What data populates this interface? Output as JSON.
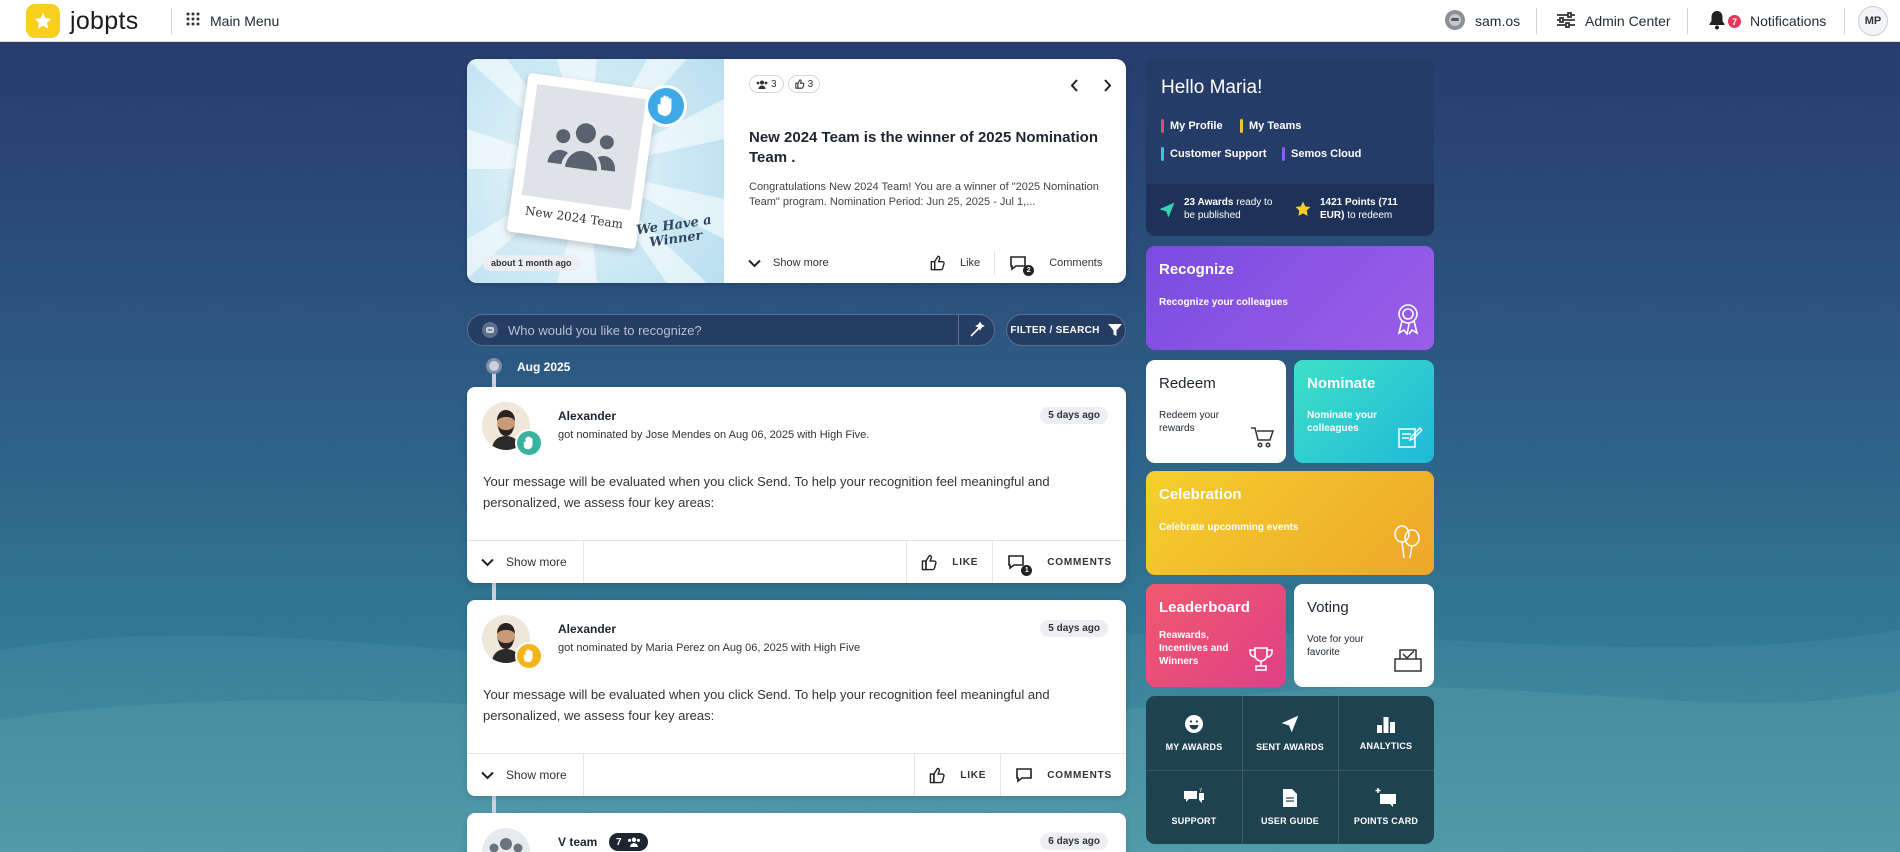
{
  "app": {
    "logo_text": "jobpts"
  },
  "topbar": {
    "main_menu": "Main Menu",
    "user": "sam.os",
    "admin": "Admin Center",
    "notifications": "Notifications",
    "notif_count": "7",
    "avatar_initials": "MP"
  },
  "feature": {
    "members_count": "3",
    "likes_count": "3",
    "img_caption": "New 2024 Team",
    "winner_text": "We Have a Winner",
    "time": "about 1 month ago",
    "title": "New 2024 Team is the winner of 2025 Nomination Team .",
    "body": "Congratulations New 2024 Team! You are a winner of \"2025 Nomination Team\" program. Nomination Period: Jun 25, 2025 - Jul 1,...",
    "show_more": "Show more",
    "like": "Like",
    "comments": "Comments",
    "comments_count": "2"
  },
  "search": {
    "placeholder": "Who would you like to recognize?",
    "filter_label": "FILTER / SEARCH"
  },
  "timeline": {
    "date": "Aug 2025"
  },
  "posts": [
    {
      "name": "Alexander",
      "subtitle": "got nominated by Jose Mendes on Aug 06, 2025 with High Five.",
      "ago": "5 days ago",
      "message": "Your message will be evaluated when you click Send. To help your recognition feel meaningful and personalized, we assess four key areas:",
      "show_more": "Show more",
      "like": "LIKE",
      "comments": "COMMENTS",
      "comments_count": "1"
    },
    {
      "name": "Alexander",
      "subtitle": "got nominated by Maria Perez on Aug 06, 2025 with High Five",
      "ago": "5 days ago",
      "message": "Your message will be evaluated when you click Send. To help your recognition feel meaningful and personalized, we assess four key areas:",
      "show_more": "Show more",
      "like": "LIKE",
      "comments": "COMMENTS"
    },
    {
      "name": "V team",
      "members": "7",
      "ago": "6 days ago"
    }
  ],
  "hello": {
    "greeting": "Hello Maria!",
    "links": [
      "My Profile",
      "My Teams",
      "Customer Support",
      "Semos Cloud"
    ],
    "link_colors": [
      "#e8457a",
      "#f2c230",
      "#38c6e0",
      "#8b5cf6"
    ],
    "awards_text": "23 Awards ready to be published",
    "awards_strong": "23 Awards",
    "awards_rest": "ready to be published",
    "points_strong": "1421 Points (711 EUR)",
    "points_rest": "to redeem"
  },
  "tiles": {
    "recognize": {
      "title": "Recognize",
      "desc": "Recognize your colleagues"
    },
    "redeem": {
      "title": "Redeem",
      "desc": "Redeem your rewards"
    },
    "nominate": {
      "title": "Nominate",
      "desc": "Nominate your colleagues"
    },
    "celebration": {
      "title": "Celebration",
      "desc": "Celebrate upcomming events"
    },
    "leaderboard": {
      "title": "Leaderboard",
      "desc": "Reawards, Incentives and Winners"
    },
    "voting": {
      "title": "Voting",
      "desc": "Vote for your favorite"
    }
  },
  "tools": [
    "MY AWARDS",
    "SENT AWARDS",
    "ANALYTICS",
    "SUPPORT",
    "USER GUIDE",
    "POINTS CARD"
  ]
}
